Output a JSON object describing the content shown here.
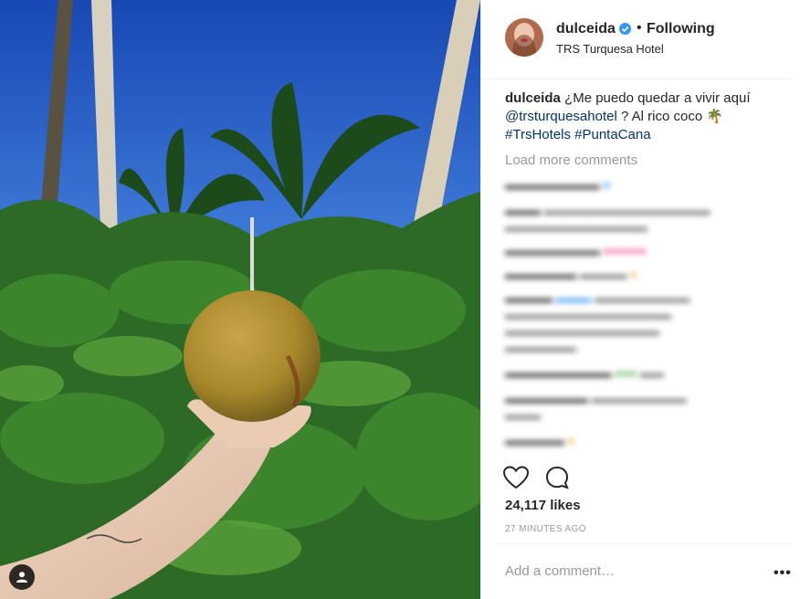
{
  "post": {
    "username": "dulceida",
    "follow_status": "Following",
    "separator": "•",
    "location": "TRS Turquesa Hotel",
    "caption": {
      "username": "dulceida",
      "text": "¿Me puedo quedar a vivir aquí",
      "mention": "@trsturquesahotel",
      "text2": "? Al rico coco",
      "emoji": "🌴",
      "hashtag1": "#TrsHotels",
      "hashtag2": "#PuntaCana"
    },
    "load_more": "Load more comments",
    "likes": "24,117 likes",
    "timestamp": "27 MINUTES AGO",
    "add_comment_placeholder": "Add a comment…",
    "more_options": "•••"
  },
  "icons": {
    "verified": "verified-badge-icon",
    "heart": "heart-icon",
    "comment": "comment-bubble-icon",
    "user_tag": "user-tag-icon",
    "more": "more-options-icon"
  },
  "colors": {
    "verified_blue": "#3897f0",
    "link": "#003569",
    "muted": "#999999"
  }
}
